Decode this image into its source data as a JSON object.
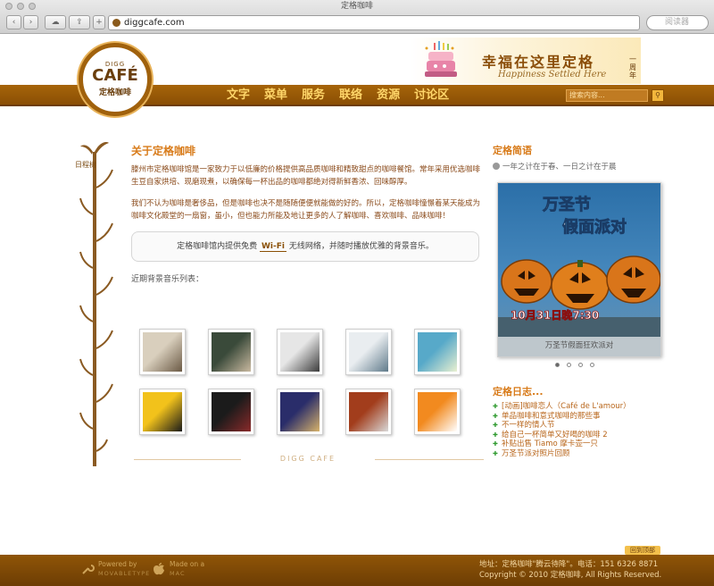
{
  "window": {
    "title": "定格咖啡"
  },
  "toolbar": {
    "url": "diggcafe.com",
    "search_placeholder": "阅读器",
    "new_tab_label": "+"
  },
  "logo": {
    "top": "DIGG",
    "main": "CAFÉ",
    "cn": "定格咖啡"
  },
  "banner": {
    "main": "幸福在这里定格",
    "sub": "Happiness Settled Here",
    "year": "一周年"
  },
  "nav": {
    "items": [
      {
        "label": "文字"
      },
      {
        "label": "菜单"
      },
      {
        "label": "服务"
      },
      {
        "label": "联络"
      },
      {
        "label": "资源"
      },
      {
        "label": "讨论区"
      }
    ],
    "search_placeholder": "搜索内容...",
    "search_button": "Q"
  },
  "timeline": {
    "label": "日程树"
  },
  "about": {
    "title": "关于定格咖啡",
    "para1": "滕州市定格咖啡馆是一家致力于以低廉的价格提供高品质咖啡和精致甜点的咖啡餐馆。常年采用优选咖啡生豆自家烘培、现磨现煮，以确保每一杯出品的咖啡都绝对得新鲜香浓、回味醇厚。",
    "para2": "我们不认为咖啡是奢侈品，但是咖啡也决不是随随便便就能做的好的。所以，定格咖啡憧憬着某天能成为咖啡文化殿堂的一扇窗，虽小，但也能力所能及地让更多的人了解咖啡、喜欢咖啡、品味咖啡！",
    "notice_before": "定格咖啡馆内提供免费",
    "notice_wifi": "Wi-Fi",
    "notice_after": "无线网络，并随时播放优雅的背景音乐。",
    "music_label": "近期背景音乐列表："
  },
  "albums": [
    {
      "name": "album-1",
      "colors": [
        "#d9cfbd",
        "#6b5a45"
      ]
    },
    {
      "name": "album-2",
      "colors": [
        "#3a4a3a",
        "#c9b9a0"
      ]
    },
    {
      "name": "album-3",
      "colors": [
        "#e6e6e6",
        "#3b3b3b"
      ]
    },
    {
      "name": "album-4",
      "colors": [
        "#e9edf0",
        "#5f7a8a"
      ]
    },
    {
      "name": "album-5",
      "colors": [
        "#57a9c9",
        "#e9f0d0"
      ]
    },
    {
      "name": "album-6",
      "colors": [
        "#f2c21b",
        "#1a1a1a"
      ]
    },
    {
      "name": "album-7",
      "colors": [
        "#1b1b1b",
        "#8a2a2a"
      ]
    },
    {
      "name": "album-8",
      "colors": [
        "#2a2d6a",
        "#d7b26a"
      ]
    },
    {
      "name": "album-9",
      "colors": [
        "#a23d1c",
        "#d8d8d8"
      ]
    },
    {
      "name": "album-10",
      "colors": [
        "#f28a1f",
        "#ffffff"
      ]
    }
  ],
  "divider": {
    "text": "DIGG CAFE"
  },
  "sidebar": {
    "title": "定格简语",
    "motto": "一年之计在于春、一日之计在于晨",
    "promo_title_1": "万圣节",
    "promo_title_2": "假面派对",
    "promo_date": "10月31日晚7:30",
    "promo_caption": "万圣节假面狂欢派对",
    "journal_title": "定格日志...",
    "journal": [
      "[动画]咖啡恋人（Café de L'amour）",
      "单品咖啡和意式咖啡的那些事",
      "不一样的情人节",
      "给自己一杯简单又好喝的咖啡 2",
      "补贴出售 Tiamo 摩卡壶一只",
      "万圣节派对照片回顾"
    ]
  },
  "footer": {
    "back_top": "回到顶部",
    "powered_by": "Powered by",
    "powered_name": "MOVABLETYPE",
    "made_on": "Made on a",
    "made_name": "MAC",
    "address": "地址：定格咖啡\"腾云待降\"。电话：151 6326 8871",
    "copyright": "Copyright © 2010 定格咖啡, All Rights Reserved."
  }
}
